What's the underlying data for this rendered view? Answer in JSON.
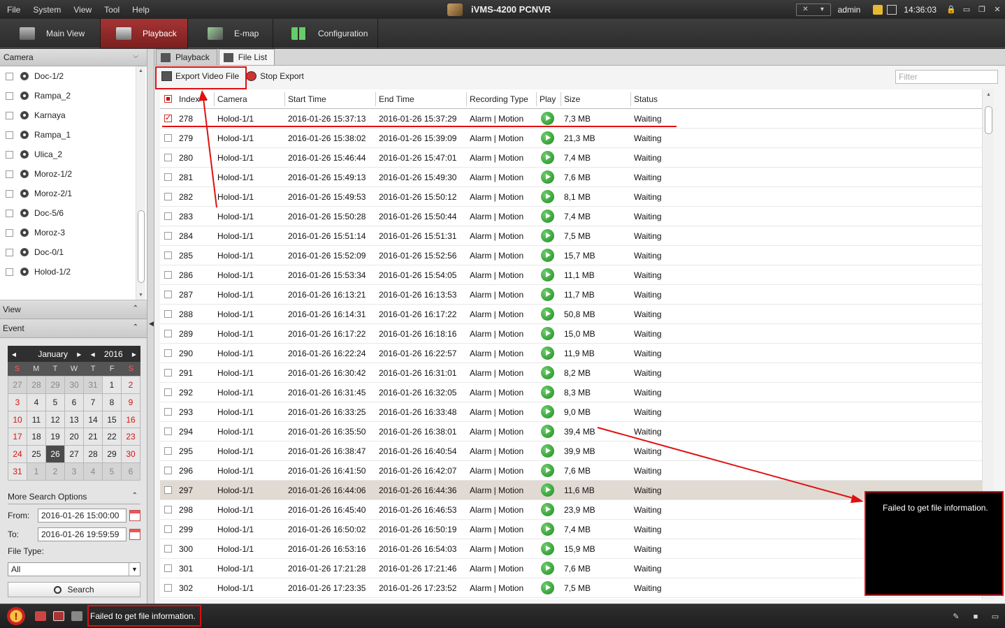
{
  "menu": [
    "File",
    "System",
    "View",
    "Tool",
    "Help"
  ],
  "app_title": "iVMS-4200  PCNVR",
  "user": "admin",
  "clock": "14:36:03",
  "window_controls": [
    "🔒",
    "▭",
    "❐",
    "✕"
  ],
  "modules": [
    {
      "label": "Main View",
      "icon": "main-view-icon"
    },
    {
      "label": "Playback",
      "icon": "playback-icon"
    },
    {
      "label": "E-map",
      "icon": "emap-icon"
    },
    {
      "label": "Configuration",
      "icon": "configuration-icon"
    }
  ],
  "left": {
    "camera_header": "Camera",
    "cameras": [
      "Doc-1/2",
      "Rampa_2",
      "Karnaya",
      "Rampa_1",
      "Ulica_2",
      "Moroz-1/2",
      "Moroz-2/1",
      "Doc-5/6",
      "Moroz-3",
      "Doc-0/1",
      "Holod-1/2"
    ],
    "view_header": "View",
    "event_header": "Event"
  },
  "calendar": {
    "month": "January",
    "year": "2016",
    "weekdays": [
      "S",
      "M",
      "T",
      "W",
      "T",
      "F",
      "S"
    ],
    "weeks": [
      [
        {
          "d": "27",
          "o": true
        },
        {
          "d": "28",
          "o": true
        },
        {
          "d": "29",
          "o": true
        },
        {
          "d": "30",
          "o": true
        },
        {
          "d": "31",
          "o": true
        },
        {
          "d": "1"
        },
        {
          "d": "2"
        }
      ],
      [
        {
          "d": "3"
        },
        {
          "d": "4"
        },
        {
          "d": "5"
        },
        {
          "d": "6"
        },
        {
          "d": "7"
        },
        {
          "d": "8"
        },
        {
          "d": "9"
        }
      ],
      [
        {
          "d": "10"
        },
        {
          "d": "11"
        },
        {
          "d": "12"
        },
        {
          "d": "13"
        },
        {
          "d": "14"
        },
        {
          "d": "15"
        },
        {
          "d": "16"
        }
      ],
      [
        {
          "d": "17"
        },
        {
          "d": "18"
        },
        {
          "d": "19"
        },
        {
          "d": "20"
        },
        {
          "d": "21"
        },
        {
          "d": "22"
        },
        {
          "d": "23"
        }
      ],
      [
        {
          "d": "24"
        },
        {
          "d": "25"
        },
        {
          "d": "26",
          "sel": true
        },
        {
          "d": "27"
        },
        {
          "d": "28"
        },
        {
          "d": "29"
        },
        {
          "d": "30"
        }
      ],
      [
        {
          "d": "31"
        },
        {
          "d": "1",
          "o": true
        },
        {
          "d": "2",
          "o": true
        },
        {
          "d": "3",
          "o": true
        },
        {
          "d": "4",
          "o": true
        },
        {
          "d": "5",
          "o": true
        },
        {
          "d": "6",
          "o": true
        }
      ]
    ]
  },
  "search": {
    "more_options": "More Search Options",
    "from_label": "From:",
    "from_value": "2016-01-26 15:00:00",
    "to_label": "To:",
    "to_value": "2016-01-26 19:59:59",
    "file_type_label": "File Type:",
    "file_type_value": "All",
    "search_label": "Search"
  },
  "subtabs": [
    "Playback",
    "File List"
  ],
  "toolbar": {
    "export_label": "Export Video File",
    "stop_label": "Stop Export",
    "filter_placeholder": "Filter"
  },
  "table": {
    "headers": [
      "Index",
      "Camera",
      "Start Time",
      "End Time",
      "Recording Type",
      "Play",
      "Size",
      "Status"
    ],
    "rows": [
      {
        "index": "278",
        "camera": "Holod-1/1",
        "start": "2016-01-26 15:37:13",
        "end": "2016-01-26 15:37:29",
        "type": "Alarm | Motion",
        "size": "7,3 MB",
        "status": "Waiting",
        "checked": true
      },
      {
        "index": "279",
        "camera": "Holod-1/1",
        "start": "2016-01-26 15:38:02",
        "end": "2016-01-26 15:39:09",
        "type": "Alarm | Motion",
        "size": "21,3 MB",
        "status": "Waiting"
      },
      {
        "index": "280",
        "camera": "Holod-1/1",
        "start": "2016-01-26 15:46:44",
        "end": "2016-01-26 15:47:01",
        "type": "Alarm | Motion",
        "size": "7,4 MB",
        "status": "Waiting"
      },
      {
        "index": "281",
        "camera": "Holod-1/1",
        "start": "2016-01-26 15:49:13",
        "end": "2016-01-26 15:49:30",
        "type": "Alarm | Motion",
        "size": "7,6 MB",
        "status": "Waiting"
      },
      {
        "index": "282",
        "camera": "Holod-1/1",
        "start": "2016-01-26 15:49:53",
        "end": "2016-01-26 15:50:12",
        "type": "Alarm | Motion",
        "size": "8,1 MB",
        "status": "Waiting"
      },
      {
        "index": "283",
        "camera": "Holod-1/1",
        "start": "2016-01-26 15:50:28",
        "end": "2016-01-26 15:50:44",
        "type": "Alarm | Motion",
        "size": "7,4 MB",
        "status": "Waiting"
      },
      {
        "index": "284",
        "camera": "Holod-1/1",
        "start": "2016-01-26 15:51:14",
        "end": "2016-01-26 15:51:31",
        "type": "Alarm | Motion",
        "size": "7,5 MB",
        "status": "Waiting"
      },
      {
        "index": "285",
        "camera": "Holod-1/1",
        "start": "2016-01-26 15:52:09",
        "end": "2016-01-26 15:52:56",
        "type": "Alarm | Motion",
        "size": "15,7 MB",
        "status": "Waiting"
      },
      {
        "index": "286",
        "camera": "Holod-1/1",
        "start": "2016-01-26 15:53:34",
        "end": "2016-01-26 15:54:05",
        "type": "Alarm | Motion",
        "size": "11,1 MB",
        "status": "Waiting"
      },
      {
        "index": "287",
        "camera": "Holod-1/1",
        "start": "2016-01-26 16:13:21",
        "end": "2016-01-26 16:13:53",
        "type": "Alarm | Motion",
        "size": "11,7 MB",
        "status": "Waiting"
      },
      {
        "index": "288",
        "camera": "Holod-1/1",
        "start": "2016-01-26 16:14:31",
        "end": "2016-01-26 16:17:22",
        "type": "Alarm | Motion",
        "size": "50,8 MB",
        "status": "Waiting"
      },
      {
        "index": "289",
        "camera": "Holod-1/1",
        "start": "2016-01-26 16:17:22",
        "end": "2016-01-26 16:18:16",
        "type": "Alarm | Motion",
        "size": "15,0 MB",
        "status": "Waiting"
      },
      {
        "index": "290",
        "camera": "Holod-1/1",
        "start": "2016-01-26 16:22:24",
        "end": "2016-01-26 16:22:57",
        "type": "Alarm | Motion",
        "size": "11,9 MB",
        "status": "Waiting"
      },
      {
        "index": "291",
        "camera": "Holod-1/1",
        "start": "2016-01-26 16:30:42",
        "end": "2016-01-26 16:31:01",
        "type": "Alarm | Motion",
        "size": "8,2 MB",
        "status": "Waiting"
      },
      {
        "index": "292",
        "camera": "Holod-1/1",
        "start": "2016-01-26 16:31:45",
        "end": "2016-01-26 16:32:05",
        "type": "Alarm | Motion",
        "size": "8,3 MB",
        "status": "Waiting"
      },
      {
        "index": "293",
        "camera": "Holod-1/1",
        "start": "2016-01-26 16:33:25",
        "end": "2016-01-26 16:33:48",
        "type": "Alarm | Motion",
        "size": "9,0 MB",
        "status": "Waiting"
      },
      {
        "index": "294",
        "camera": "Holod-1/1",
        "start": "2016-01-26 16:35:50",
        "end": "2016-01-26 16:38:01",
        "type": "Alarm | Motion",
        "size": "39,4 MB",
        "status": "Waiting"
      },
      {
        "index": "295",
        "camera": "Holod-1/1",
        "start": "2016-01-26 16:38:47",
        "end": "2016-01-26 16:40:54",
        "type": "Alarm | Motion",
        "size": "39,9 MB",
        "status": "Waiting"
      },
      {
        "index": "296",
        "camera": "Holod-1/1",
        "start": "2016-01-26 16:41:50",
        "end": "2016-01-26 16:42:07",
        "type": "Alarm | Motion",
        "size": "7,6 MB",
        "status": "Waiting"
      },
      {
        "index": "297",
        "camera": "Holod-1/1",
        "start": "2016-01-26 16:44:06",
        "end": "2016-01-26 16:44:36",
        "type": "Alarm | Motion",
        "size": "11,6 MB",
        "status": "Waiting",
        "highlight": true
      },
      {
        "index": "298",
        "camera": "Holod-1/1",
        "start": "2016-01-26 16:45:40",
        "end": "2016-01-26 16:46:53",
        "type": "Alarm | Motion",
        "size": "23,9 MB",
        "status": "Waiting"
      },
      {
        "index": "299",
        "camera": "Holod-1/1",
        "start": "2016-01-26 16:50:02",
        "end": "2016-01-26 16:50:19",
        "type": "Alarm | Motion",
        "size": "7,4 MB",
        "status": "Waiting"
      },
      {
        "index": "300",
        "camera": "Holod-1/1",
        "start": "2016-01-26 16:53:16",
        "end": "2016-01-26 16:54:03",
        "type": "Alarm | Motion",
        "size": "15,9 MB",
        "status": "Waiting"
      },
      {
        "index": "301",
        "camera": "Holod-1/1",
        "start": "2016-01-26 17:21:28",
        "end": "2016-01-26 17:21:46",
        "type": "Alarm | Motion",
        "size": "7,6 MB",
        "status": "Waiting"
      },
      {
        "index": "302",
        "camera": "Holod-1/1",
        "start": "2016-01-26 17:23:35",
        "end": "2016-01-26 17:23:52",
        "type": "Alarm | Motion",
        "size": "7,5 MB",
        "status": "Waiting"
      }
    ]
  },
  "status_message": "Failed to get file information.",
  "popup_message": "Failed to get file information.",
  "colors": {
    "accent": "#a63434",
    "annotation": "#e01010",
    "play": "#1d8a1d"
  }
}
